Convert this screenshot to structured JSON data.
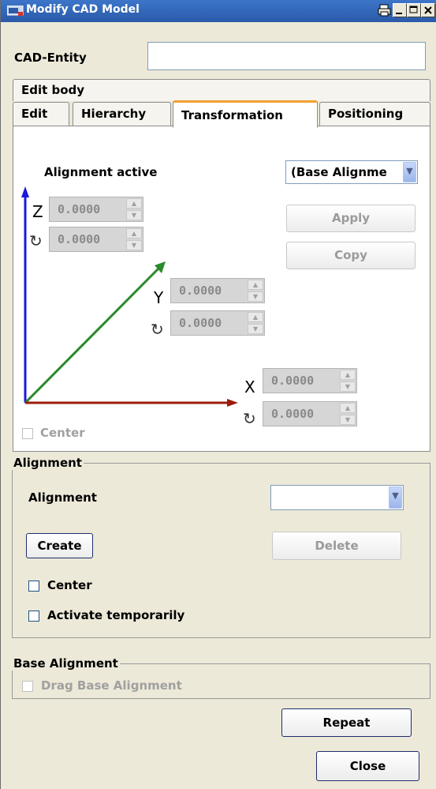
{
  "window": {
    "title": "Modify CAD Model",
    "controls": [
      "print",
      "minimize",
      "maximize",
      "close"
    ]
  },
  "cad_entity": {
    "label": "CAD-Entity",
    "value": ""
  },
  "tabs": {
    "row1": [
      {
        "label": "Edit body"
      }
    ],
    "row2": [
      {
        "label": "Edit",
        "active": false
      },
      {
        "label": "Hierarchy",
        "active": false
      },
      {
        "label": "Transformation",
        "active": true
      },
      {
        "label": "Positioning",
        "active": false
      }
    ]
  },
  "transformation": {
    "alignment_active_label": "Alignment active",
    "alignment_active_value": "(Base Alignme",
    "apply_label": "Apply",
    "copy_label": "Copy",
    "z": {
      "axis": "Z",
      "translation": "0.0000",
      "rotation": "0.0000"
    },
    "y": {
      "axis": "Y",
      "translation": "0.0000",
      "rotation": "0.0000"
    },
    "x": {
      "axis": "X",
      "translation": "0.0000",
      "rotation": "0.0000"
    },
    "center_label": "Center",
    "axis_colors": {
      "z": "#1a1adc",
      "y": "#2a8a2a",
      "x": "#9b1c0c"
    }
  },
  "alignment_group": {
    "legend": "Alignment",
    "alignment_label": "Alignment",
    "alignment_value": "",
    "create_label": "Create",
    "delete_label": "Delete",
    "center_label": "Center",
    "activate_label": "Activate temporarily"
  },
  "base_alignment_group": {
    "legend": "Base Alignment",
    "drag_label": "Drag Base Alignment"
  },
  "buttons": {
    "repeat": "Repeat",
    "close": "Close"
  }
}
